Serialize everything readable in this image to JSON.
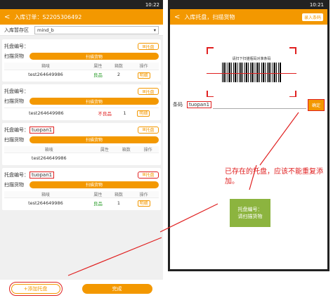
{
  "left": {
    "status_time": "10:22",
    "title": "入库订单：S2205306492",
    "area_label": "入库暂存区",
    "area_value": "mind_b",
    "pallet_label": "托盘编号：",
    "scan_label": "扫描货物",
    "pallet_btn": "托盘",
    "scan_btn": "扫描货物",
    "table_headers": [
      "箱唛",
      "属性",
      "箱数",
      "操作"
    ],
    "detail_label": "明细",
    "cards": [
      {
        "pallet": "",
        "box": "test264649986",
        "attr": "良品",
        "count": "2"
      },
      {
        "pallet": "",
        "box": "test264649986",
        "attr": "不良品",
        "count": "1"
      },
      {
        "pallet": "tuopan1",
        "box": "test264649986",
        "attr": "",
        "count": ""
      },
      {
        "pallet": "tuopan1",
        "box": "test264649986",
        "attr": "良品",
        "count": "1"
      }
    ],
    "add_pallet": "+添加托盘",
    "done": "完成"
  },
  "right": {
    "status_time": "10:21",
    "title": "入库托盘，扫描货物",
    "manual_btn": "录入条码",
    "scan_hint": "请扫下扫描瓶码对准条码",
    "code_label": "条码",
    "code_value": "tuopan1",
    "confirm": "确定"
  },
  "annotation": {
    "note": "已存在的托盘，应该不能重复添加。",
    "green_line1": "托盘编号：",
    "green_line2": "请扫描货物"
  }
}
